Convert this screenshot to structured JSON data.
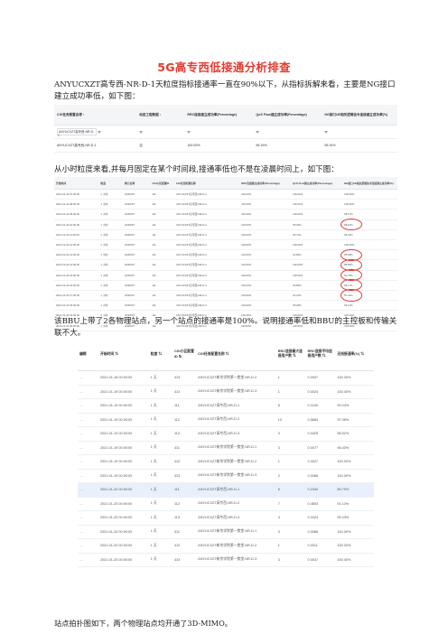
{
  "title": "5G高专西低接通分析排查",
  "paragraphs": {
    "p1": "ANYUCXZT高专西-NR-D-1天粒度指标接通率一直在90%以下，从指标拆解来看，主要是NG接口建立成功率低，如下图：",
    "p2": "从小时粒度来看,并每月固定在某个时间段,接通率低也不是在凌晨时间上，如下图：",
    "p3": "该BBU上带了2各物理站点，另一个站点的接通率是100%。说明接通率低和BBU的主控板和传输关联不大。",
    "p4": "站点拍扑图如下，两个物理站点均开通了3D-MIMO。"
  },
  "table1": {
    "headers": [
      "CGI任务配置名称 ↕",
      "动态工程数据 ↕",
      "RRC连接建立成功率(Percentage)",
      "QoS Flow建立成功率(Percentage)",
      "NG接口UE相关逻辑信令连接建立成功率(%)"
    ],
    "filter_row": [
      "ANYUCXZT高专西-NR-D-1",
      "",
      "",
      "",
      ""
    ],
    "rows": [
      [
        "ANYUCXZT高专西-NR-D-1",
        "否",
        "100.00%",
        "96.19%",
        "55.34%"
      ]
    ]
  },
  "table2": {
    "headers": [
      "开始时间",
      "粒度",
      "网元名称",
      "CGI小区配置ID",
      "CGI任务配置名称",
      "RRC连接建立成功率(Percentage)",
      "QoS Flow建立成功率(Percentage)",
      "NG接口UE相关逻辑信令连接建立成功率(%)"
    ],
    "rows": [
      [
        "2021-01-20 07:00:00",
        "1 小时",
        "HSRXZT",
        "111",
        "ANYUCXZT高专西-NR-D-1",
        "100.00%",
        "100.00%",
        "100.00%"
      ],
      [
        "2021-01-20 08:00:00",
        "1 小时",
        "HSRXZT",
        "111",
        "ANYUCXZT高专西-NR-D-1",
        "100.00%",
        "100.00%",
        "100.00%"
      ],
      [
        "2021-01-20 09:00:00",
        "1 小时",
        "HSRXZT",
        "111",
        "ANYUCXZT高专西-NR-D-1",
        "100.00%",
        "100.00%",
        "98.17%"
      ],
      [
        "2021-01-20 10:00:00",
        "1 小时",
        "HSRXZT",
        "111",
        "ANYUCXZT高专西-NR-D-1",
        "100.00%",
        "95.03%",
        "88.61%"
      ],
      [
        "2021-01-20 11:00:00",
        "1 小时",
        "HSRXZT",
        "111",
        "ANYUCXZT高专西-NR-D-1",
        "100.00%",
        "95.71%",
        "95.19%"
      ],
      [
        "2021-01-20 12:00:00",
        "1 小时",
        "HSRXZT",
        "111",
        "ANYUCXZT高专西-NR-D-1",
        "100.00%",
        "100.00%",
        "100.00%"
      ],
      [
        "2021-01-20 13:00:00",
        "1 小时",
        "HSRXZT",
        "111",
        "ANYUCXZT高专西-NR-D-1",
        "100.00%",
        "91.80%",
        "85.96%"
      ],
      [
        "2021-01-20 14:00:00",
        "1 小时",
        "HSRXZT",
        "111",
        "ANYUCXZT高专西-NR-D-1",
        "100.00%",
        "100.00%",
        "88.85%"
      ],
      [
        "2021-01-20 15:00:00",
        "1 小时",
        "HSRXZT",
        "111",
        "ANYUCXZT高专西-NR-D-1",
        "100.00%",
        "100.00%",
        "80.78%"
      ],
      [
        "2021-01-20 16:00:00",
        "1 小时",
        "HSRXZT",
        "111",
        "ANYUCXZT高专西-NR-D-1",
        "100.00%",
        "90.80%",
        "83.17%"
      ],
      [
        "2021-01-20 17:00:00",
        "1 小时",
        "HSRXZT",
        "111",
        "ANYUCXZT高专西-NR-D-1",
        "100.00%",
        "91.21%",
        "87.22%"
      ],
      [
        "2021-01-20 18:00:00",
        "1 小时",
        "HSRXZT",
        "111",
        "ANYUCXZT高专西-NR-D-1",
        "100.00%",
        "95.29%",
        "93.11%"
      ],
      [
        "2021-01-20 19:00:00",
        "1 小时",
        "HSRXZT",
        "111",
        "ANYUCXZT高专西-NR-D-1",
        "100.00%",
        "100.00%",
        "100.00%"
      ],
      [
        "2021-01-20 20:00:00",
        "1 小时",
        "HSRXZT",
        "111",
        "ANYUCXZT高专西-NR-D-1",
        "100.00%",
        "100.00%",
        "100.00%"
      ]
    ]
  },
  "table3": {
    "headers": [
      "编辑",
      "开始时间 ⇅",
      "粒度 ⇅",
      "CGI小区配置ID ⇅",
      "CGI任务配置名称 ⇅",
      "RRC连接最大连接用户数 ⇅",
      "RRC连接平均连接用户数 ⇅",
      "无线接通率(%) ⇅"
    ],
    "rows": [
      [
        "…",
        "2021-01-18 00:00:00",
        "1 天",
        "413",
        "ANYUCXZT新余学院第一食堂-NR-D-2",
        "1",
        "0.0007",
        "100.00%"
      ],
      [
        "…",
        "2021-01-19 00:00:00",
        "1 天",
        "413",
        "ANYUCXZT新余学院第一食堂-NR-D-3",
        "1",
        "0.0024",
        "100.00%"
      ],
      [
        "…",
        "2021-01-19 00:00:00",
        "1 天",
        "111",
        "ANYUCXZT高专西-NR-D-1",
        "6",
        "0.1150",
        "90.04%"
      ],
      [
        "…",
        "2021-01-19 00:00:00",
        "1 天",
        "112",
        "ANYUCXZT高专西-NR-D-2",
        "10",
        "0.5684",
        "97.08%"
      ],
      [
        "…",
        "2021-01-19 00:00:00",
        "1 天",
        "113",
        "ANYUCXZT高专西-NR-D-3",
        "3",
        "0.0429",
        "98.52%"
      ],
      [
        "…",
        "2021-01-19 00:00:00",
        "1 天",
        "411",
        "ANYUCXZT新余学院第一食堂-NR-D-1",
        "3",
        "0.0077",
        "98.43%"
      ],
      [
        "…",
        "2021-01-19 00:00:00",
        "1 天",
        "412",
        "ANYUCXZT新余学院第一食堂-NR-D-2",
        "1",
        "0.0027",
        "100.00%"
      ],
      [
        "…",
        "2021-01-19 00:00:00",
        "1 天",
        "413",
        "ANYUCXZT新余学院第一食堂-NR-D-3",
        "2",
        "0.0086",
        "100.00%"
      ],
      [
        "…",
        "2021-01-20 00:00:00",
        "1 天",
        "111",
        "ANYUCXZT高专西-NR-D-1",
        "6",
        "0.2340",
        "89.79%"
      ],
      [
        "…",
        "2021-01-20 00:00:00",
        "1 天",
        "112",
        "ANYUCXZT高专西-NR-D-2",
        "7",
        "0.4803",
        "91.13%"
      ],
      [
        "…",
        "2021-01-20 00:00:00",
        "1 天",
        "113",
        "ANYUCXZT高专西-NR-D-3",
        "4",
        "0.0424",
        "95.23%"
      ],
      [
        "…",
        "2021-01-20 00:00:00",
        "1 天",
        "411",
        "ANYUCXZT新余学院第一食堂-NR-D-1",
        "3",
        "0.0086",
        "100.00%"
      ],
      [
        "…",
        "2021-01-20 00:00:00",
        "1 天",
        "412",
        "ANYUCXZT新余学院第一食堂-NR-D-2",
        "1",
        "0.0011",
        "100.00%"
      ],
      [
        "…",
        "2021-01-20 00:00:00",
        "1 天",
        "413",
        "ANYUCXZT新余学院第一食堂-NR-D-3",
        "3",
        "0.0047",
        "100.00%"
      ]
    ],
    "highlighted_row": 8
  },
  "colors": {
    "title": "#e23b2f",
    "annotation_circle": "#e23b2f",
    "highlight_row": "#e8f1fb"
  }
}
